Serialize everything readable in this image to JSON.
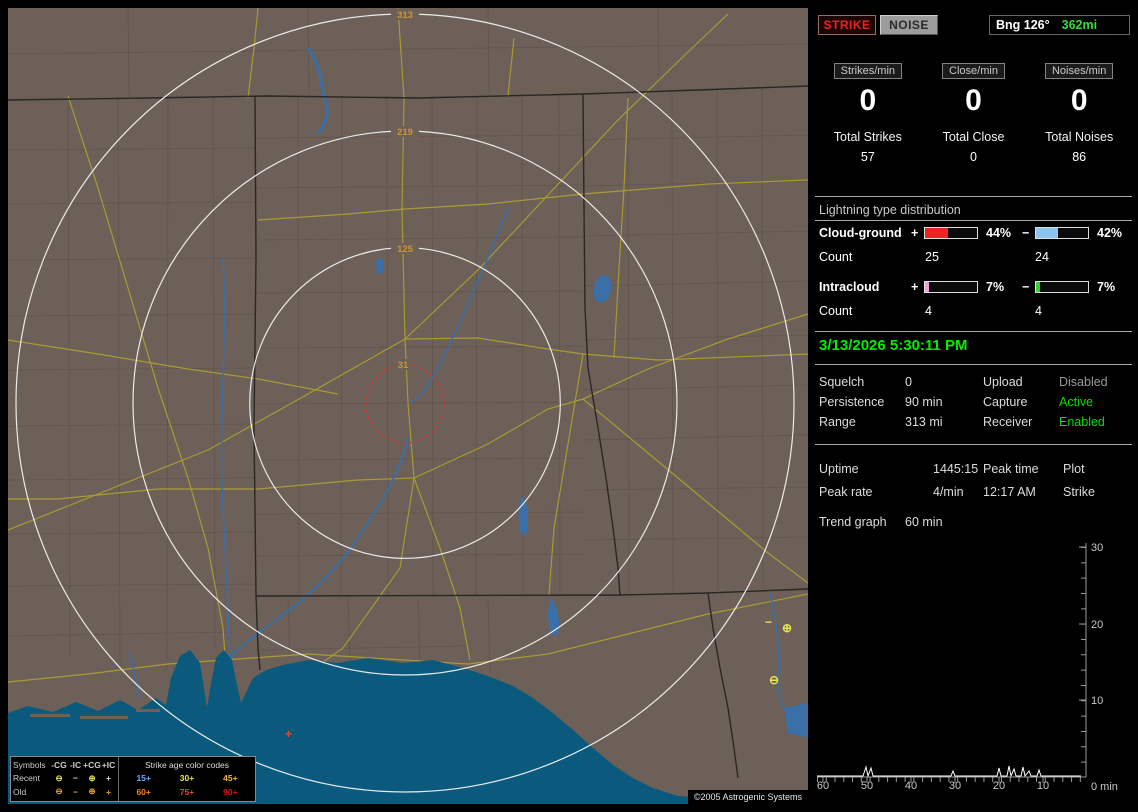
{
  "colors": {
    "strike_red": "#ee2222",
    "distance_green": "#33dd33",
    "clock_green": "#00ee00"
  },
  "map": {
    "range_labels": [
      "313",
      "219",
      "125",
      "31"
    ],
    "copyright": "©2005 Astrogenic Systems",
    "markers": [
      {
        "symbol": "+",
        "color": "#e84a22"
      },
      {
        "symbol": "−",
        "color": "#e6e64e"
      },
      {
        "symbol": "⊕",
        "color": "#e6e64e"
      },
      {
        "symbol": "⊖",
        "color": "#e6e64e"
      }
    ],
    "legend": {
      "symbols_header": "Symbols",
      "col_headers": [
        "-CG",
        "-IC",
        "+CG",
        "+IC"
      ],
      "age_title": "Strike age color codes",
      "rows": [
        {
          "label": "Recent",
          "glyphs": [
            "⊖",
            "−",
            "⊕",
            "+"
          ],
          "glyph_colors": [
            "#e6e64e",
            "#d8d8d8",
            "#e6e64e",
            "#d8d8d8"
          ],
          "ages": [
            "15+",
            "30+",
            "45+"
          ],
          "age_colors": [
            "#6fa8ff",
            "#e6e64e",
            "#f0b832"
          ]
        },
        {
          "label": "Old",
          "glyphs": [
            "⊖",
            "−",
            "⊕",
            "+"
          ],
          "glyph_colors": [
            "#e0a32e",
            "#e0a32e",
            "#e0a32e",
            "#e0a32e"
          ],
          "ages": [
            "60+",
            "75+",
            "90+"
          ],
          "age_colors": [
            "#f08426",
            "#ee4422",
            "#e01010"
          ]
        }
      ]
    }
  },
  "panel": {
    "toolbar": {
      "strike": "STRIKE",
      "noise": "NOISE",
      "bearing": "Bng 126°",
      "distance": "362mi"
    },
    "counters": [
      {
        "header": "Strikes/min",
        "rate": "0",
        "total_label": "Total Strikes",
        "total": "57"
      },
      {
        "header": "Close/min",
        "rate": "0",
        "total_label": "Total Close",
        "total": "0"
      },
      {
        "header": "Noises/min",
        "rate": "0",
        "total_label": "Total Noises",
        "total": "86"
      }
    ],
    "distribution": {
      "title": "Lightning type distribution",
      "rows": [
        {
          "label": "Cloud-ground",
          "plus_sign": "+",
          "plus_pct": "44%",
          "plus_color": "#ee2222",
          "minus_sign": "−",
          "minus_pct": "42%",
          "minus_color": "#8cc4f0",
          "count_label": "Count",
          "plus_count": "25",
          "minus_count": "24"
        },
        {
          "label": "Intracloud",
          "plus_sign": "+",
          "plus_pct": "7%",
          "plus_color": "#f2a0d8",
          "minus_sign": "−",
          "minus_pct": "7%",
          "minus_color": "#35d035",
          "count_label": "Count",
          "plus_count": "4",
          "minus_count": "4"
        }
      ]
    },
    "clock": "3/13/2026 5:30:11 PM",
    "settings": [
      {
        "k1": "Squelch",
        "v1": "0",
        "k2": "Upload",
        "v2": "Disabled",
        "v2_color": "#9a9a9a"
      },
      {
        "k1": "Persistence",
        "v1": "90 min",
        "k2": "Capture",
        "v2": "Active",
        "v2_color": "#00dd00"
      },
      {
        "k1": "Range",
        "v1": "313 mi",
        "k2": "Receiver",
        "v2": "Enabled",
        "v2_color": "#00dd00"
      }
    ],
    "stats": {
      "uptime_label": "Uptime",
      "uptime": "1445:15",
      "peak_time_label": "Peak time",
      "peak_time": "12:17 AM",
      "plot_label": "Plot",
      "plot_value": "Strike",
      "peak_rate_label": "Peak rate",
      "peak_rate": "4/min",
      "trend_label": "Trend graph",
      "trend_window": "60 min"
    },
    "trend": {
      "y_ticks": [
        "30",
        "20",
        "10"
      ],
      "x_ticks": [
        "60",
        "50",
        "40",
        "30",
        "20",
        "10"
      ],
      "origin_label": "0 min"
    }
  }
}
